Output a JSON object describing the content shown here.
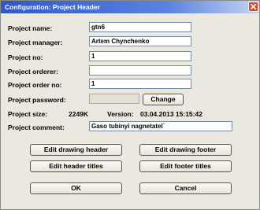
{
  "window": {
    "title": "Configuration: Project Header"
  },
  "fields": {
    "project_name": {
      "label": "Project name:",
      "value": "gtn6"
    },
    "project_manager": {
      "label": "Project manager:",
      "value": "Artem Chynchenko"
    },
    "project_no": {
      "label": "Project no:",
      "value": "1"
    },
    "project_orderer": {
      "label": "Project orderer:",
      "value": ""
    },
    "project_order_no": {
      "label": "Project order no:",
      "value": "1"
    },
    "project_password": {
      "label": "Project password:",
      "value": ""
    },
    "project_comment": {
      "label": "Project comment:",
      "value": "Gaso tubinyi nagnetatel`"
    }
  },
  "info": {
    "size_label": "Project size:",
    "size_value": "2249K",
    "version_label": "Version:",
    "version_value": "03.04.2013 15:15:42"
  },
  "buttons": {
    "change": "Change",
    "edit_drawing_header": "Edit drawing header",
    "edit_drawing_footer": "Edit drawing footer",
    "edit_header_titles": "Edit header titles",
    "edit_footer_titles": "Edit footer titles",
    "ok": "OK",
    "cancel": "Cancel"
  }
}
